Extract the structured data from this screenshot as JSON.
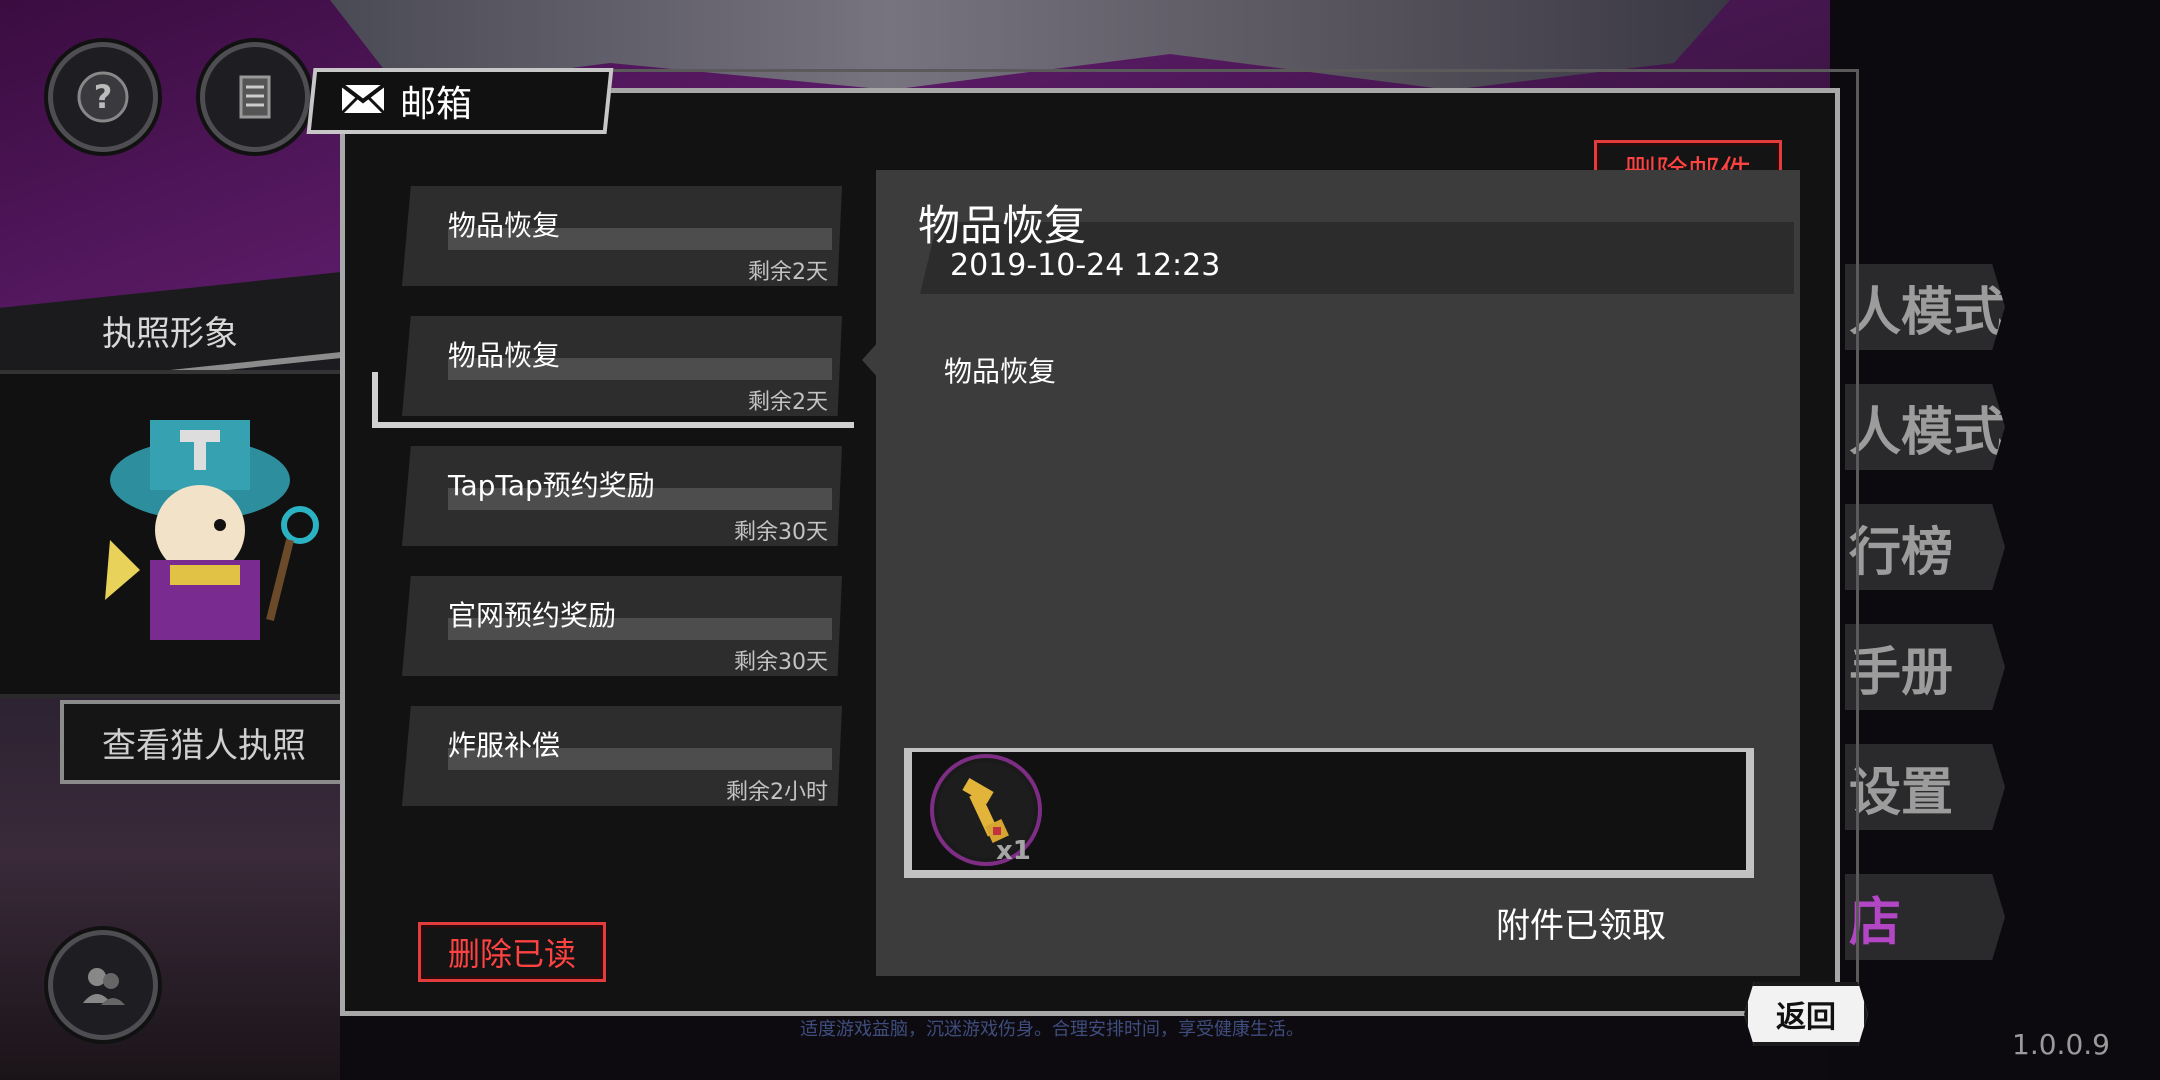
{
  "background": {
    "license_label": "执照形象",
    "view_license_button": "查看猎人执照",
    "footer_notice": "适度游戏益脑，沉迷游戏伤身。合理安排时间，享受健康生活。",
    "version": "1.0.0.9",
    "right_menu": [
      {
        "label": "人模式"
      },
      {
        "label": "人模式"
      },
      {
        "label": "行榜"
      },
      {
        "label": "手册"
      },
      {
        "label": "设置"
      },
      {
        "label": "店"
      }
    ]
  },
  "mailbox": {
    "title": "邮箱",
    "delete_mail_button": "删除邮件",
    "delete_read_button": "删除已读",
    "items": [
      {
        "name": "物品恢复",
        "remaining": "剩余2天"
      },
      {
        "name": "物品恢复",
        "remaining": "剩余2天"
      },
      {
        "name": "TapTap预约奖励",
        "remaining": "剩余30天"
      },
      {
        "name": "官网预约奖励",
        "remaining": "剩余30天"
      },
      {
        "name": "炸服补偿",
        "remaining": "剩余2小时"
      }
    ],
    "selected_index": 1,
    "detail": {
      "title": "物品恢复",
      "datetime": "2019-10-24 12:23",
      "body": "物品恢复",
      "attachment": {
        "icon": "key-icon",
        "quantity": "x1"
      },
      "status": "附件已领取"
    },
    "back_button": "返回"
  },
  "colors": {
    "accent_red": "#e33c3c",
    "purple": "#7e2d85",
    "panel": "#3c3c3c"
  }
}
